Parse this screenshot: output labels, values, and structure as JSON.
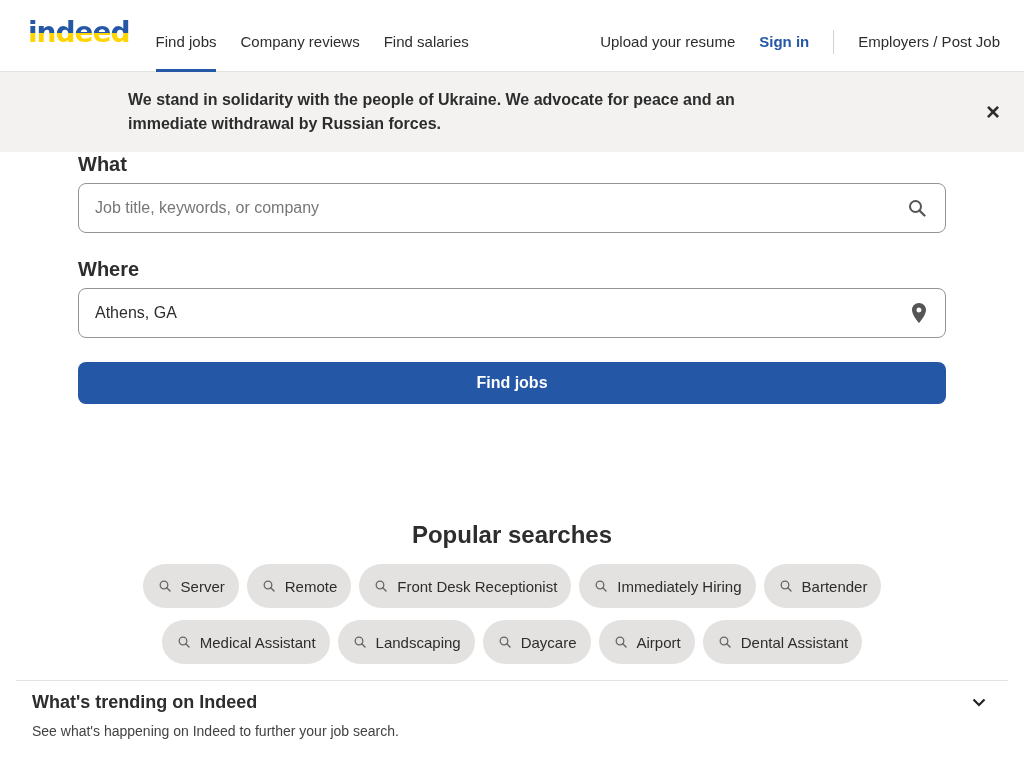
{
  "header": {
    "logo": "indeed",
    "nav": [
      {
        "label": "Find jobs",
        "selected": true
      },
      {
        "label": "Company reviews",
        "selected": false
      },
      {
        "label": "Find salaries",
        "selected": false
      }
    ],
    "upload": "Upload your resume",
    "sign_in": "Sign in",
    "employers": "Employers / Post Job"
  },
  "banner": {
    "text": "We stand in solidarity with the people of Ukraine. We advocate for peace and an immediate withdrawal by Russian forces.",
    "close": "×"
  },
  "search": {
    "what_label": "What",
    "what_placeholder": "Job title, keywords, or company",
    "where_label": "Where",
    "where_value": "Athens, GA",
    "button": "Find jobs"
  },
  "popular": {
    "title": "Popular searches",
    "chips": [
      "Server",
      "Remote",
      "Front Desk Receptionist",
      "Immediately Hiring",
      "Bartender",
      "Medical Assistant",
      "Landscaping",
      "Daycare",
      "Airport",
      "Dental Assistant"
    ]
  },
  "trending": {
    "title": "What's trending on Indeed",
    "subtitle": "See what's happening on Indeed to further your job search."
  }
}
